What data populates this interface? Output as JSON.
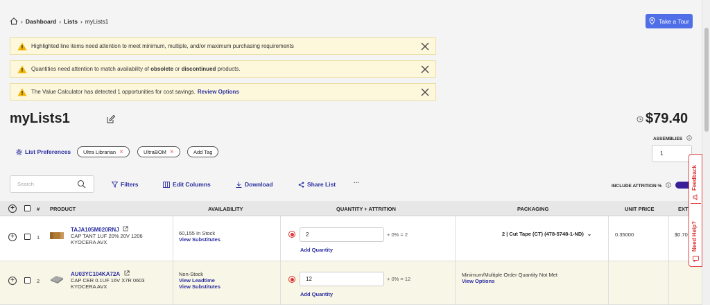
{
  "breadcrumb": {
    "dashboard": "Dashboard",
    "lists": "Lists",
    "current": "myLists1"
  },
  "tour_button": "Take a Tour",
  "alerts": {
    "a1": "Highlighted line items need attention to meet minimum, multiple, and/or maximum purchasing requirements",
    "a2_pre": "Quantities need attention to match availability of",
    "a2_b1": "obsolete",
    "a2_mid": "or",
    "a2_b2": "discontinued",
    "a2_post": "products.",
    "a3_text": "The Value Calculator has detected 1 opportunities for cost savings.",
    "a3_link": "Review Options"
  },
  "list_title": "myLists1",
  "total_price": "$79.40",
  "assemblies": {
    "label": "ASSEMBLIES",
    "value": "1"
  },
  "list_preferences": "List Preferences",
  "tags": [
    "Ultra Librarian",
    "UltraBOM"
  ],
  "add_tag": "Add Tag",
  "search_placeholder": "Search",
  "toolbar": {
    "filters": "Filters",
    "edit_columns": "Edit Columns",
    "download": "Download",
    "share": "Share List",
    "more": "···"
  },
  "include_attrition": "INCLUDE ATTRITION %",
  "columns": {
    "hash": "#",
    "product": "PRODUCT",
    "availability": "AVAILABILITY",
    "quantity": "QUANTITY + ATTRITION",
    "packaging": "PACKAGING",
    "unit_price": "UNIT PRICE",
    "extended": "EXTENDE"
  },
  "rows": [
    {
      "num": "1",
      "part": "TAJA105M020RNJ",
      "desc": "CAP TANT 1UF 20% 20V 1206",
      "mfr": "KYOCERA AVX",
      "stock": "60,155 In Stock",
      "link1": "View Substitutes",
      "qty": "2",
      "calc": "+ 0% = 2",
      "add_qty": "Add Quantity",
      "packaging": "2 | Cut Tape (CT)  (478-5748-1-ND)",
      "unit_price": "0.35000",
      "extended": "$0.70"
    },
    {
      "num": "2",
      "part": "AU03YC104KA72A",
      "desc": "CAP CER 0.1UF 16V X7R 0603",
      "mfr": "KYOCERA AVX",
      "stock": "Non-Stock",
      "link1": "View Leadtime",
      "link2": "View Substitutes",
      "qty": "12",
      "calc": "+ 0% = 12",
      "add_qty": "Add Quantity",
      "packaging_note": "Minimum/Multiple Order Quantity Not Met",
      "packaging_link": "View Options"
    }
  ],
  "side_tab": {
    "feedback": "Feedback",
    "help": "Need Help?"
  }
}
